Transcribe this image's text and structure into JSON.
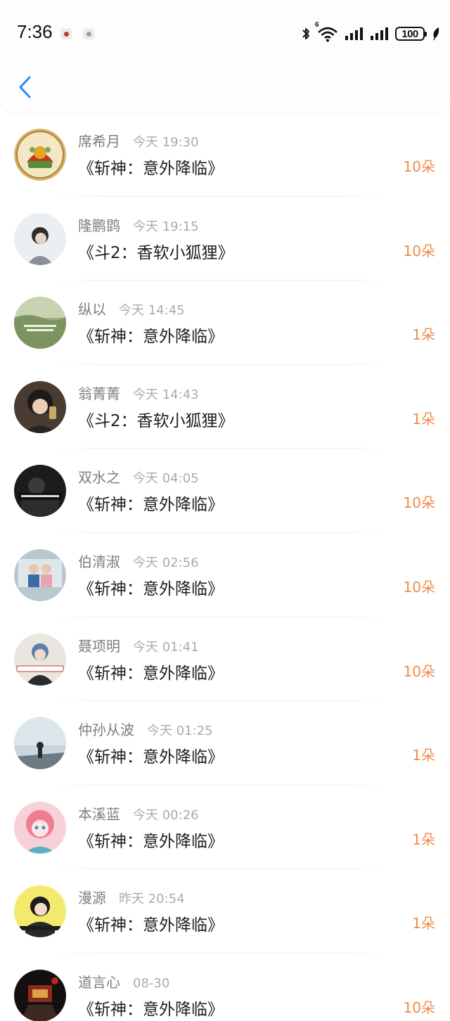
{
  "status_bar": {
    "time": "7:36",
    "battery_level": "100",
    "network_label": "6"
  },
  "header": {
    "back_icon": "chevron-left-icon"
  },
  "colors": {
    "accent_blue": "#2b8cf0",
    "amount_orange": "#ef8a47",
    "name_gray": "#7d7d7d",
    "time_gray": "#ababab",
    "title_black": "#1e1e1e"
  },
  "gifts": [
    {
      "name": "席希月",
      "time": "今天 19:30",
      "title": "《斩神：意外降临》",
      "amount": "10朵"
    },
    {
      "name": "隆鹏鹍",
      "time": "今天 19:15",
      "title": "《斗2：香软小狐狸》",
      "amount": "10朵"
    },
    {
      "name": "纵以",
      "time": "今天 14:45",
      "title": "《斩神：意外降临》",
      "amount": "1朵"
    },
    {
      "name": "翁菁菁",
      "time": "今天 14:43",
      "title": "《斗2：香软小狐狸》",
      "amount": "1朵"
    },
    {
      "name": "双水之",
      "time": "今天 04:05",
      "title": "《斩神：意外降临》",
      "amount": "10朵"
    },
    {
      "name": "伯清淑",
      "time": "今天 02:56",
      "title": "《斩神：意外降临》",
      "amount": "10朵"
    },
    {
      "name": "聂项明",
      "time": "今天 01:41",
      "title": "《斩神：意外降临》",
      "amount": "10朵"
    },
    {
      "name": "仲孙从波",
      "time": "今天 01:25",
      "title": "《斩神：意外降临》",
      "amount": "1朵"
    },
    {
      "name": "本溪蓝",
      "time": "今天 00:26",
      "title": "《斩神：意外降临》",
      "amount": "1朵"
    },
    {
      "name": "漫源",
      "time": "昨天 20:54",
      "title": "《斩神：意外降临》",
      "amount": "1朵"
    },
    {
      "name": "道言心",
      "time": "08-30",
      "title": "《斩神：意外降临》",
      "amount": "10朵"
    }
  ]
}
